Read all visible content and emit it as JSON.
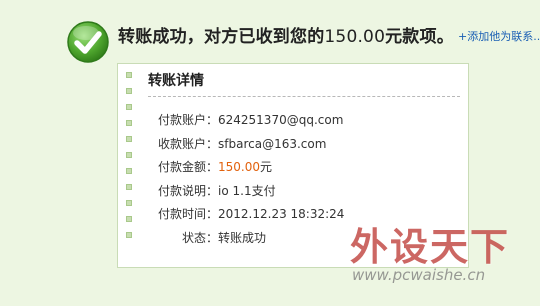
{
  "headline": {
    "text_before": "转账成功，对方已收到您的",
    "amount": "150.00",
    "text_after": "元款项。"
  },
  "add_contact_link": "+添加他为联系...",
  "card": {
    "title": "转账详情",
    "rows": [
      {
        "label": "付款账户：",
        "value": "624251370@qq.com"
      },
      {
        "label": "收款账户：",
        "value": "sfbarca@163.com"
      },
      {
        "label": "付款金额：",
        "value": "150.00",
        "unit": "元"
      },
      {
        "label": "付款说明：",
        "value": "io 1.1支付"
      },
      {
        "label": "付款时间：",
        "value": "2012.12.23 18:32:24"
      },
      {
        "label": "状态：",
        "value": "转账成功"
      }
    ]
  },
  "watermark": {
    "text": "外设天下",
    "url": "www.pcwaishe.cn"
  },
  "colors": {
    "background": "#edf6e2",
    "success_green": "#5aa63a",
    "amount_orange": "#e2620e",
    "link_blue": "#1a5fb4"
  },
  "icons": {
    "success": "check-circle-icon"
  }
}
